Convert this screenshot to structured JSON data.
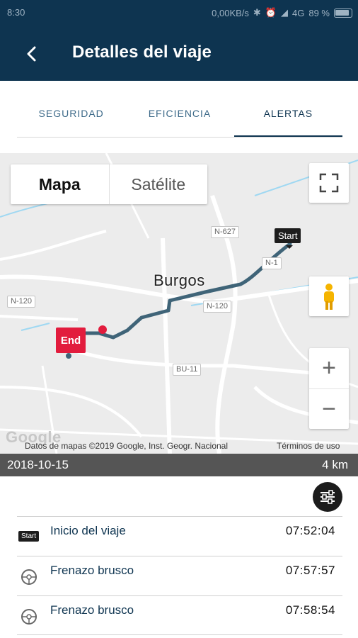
{
  "status_bar": {
    "time": "8:30",
    "speed": "0,00KB/s",
    "network": "4G",
    "battery": "89 %"
  },
  "header": {
    "title": "Detalles del viaje",
    "back_icon": "arrow-left-icon"
  },
  "tabs": [
    {
      "label": "SEGURIDAD",
      "active": false
    },
    {
      "label": "EFICIENCIA",
      "active": false
    },
    {
      "label": "ALERTAS",
      "active": true
    }
  ],
  "map": {
    "type_options": [
      "Mapa",
      "Satélite"
    ],
    "selected_type": "Mapa",
    "city_label": "Burgos",
    "road_labels": [
      "N-627",
      "N-120",
      "N-120",
      "BU-11",
      "N-1"
    ],
    "start_label": "Start",
    "end_label": "End",
    "google_logo": "Google",
    "copyright": "Datos de mapas ©2019 Google, Inst. Geogr. Nacional",
    "terms": "Términos de uso",
    "zoom_in": "+",
    "zoom_out": "−",
    "route_color": "#3f6478",
    "end_color": "#e21c3d"
  },
  "trip": {
    "date": "2018-10-15",
    "distance": "4 km"
  },
  "alerts": [
    {
      "icon": "start-flag-icon",
      "icon_text": "Start",
      "label": "Inicio del viaje",
      "time": "07:52:04"
    },
    {
      "icon": "steering-wheel-icon",
      "label": "Frenazo brusco",
      "time": "07:57:57"
    },
    {
      "icon": "steering-wheel-icon",
      "label": "Frenazo brusco",
      "time": "07:58:54"
    }
  ],
  "colors": {
    "primary": "#0e3450",
    "summary_bar": "#555555"
  }
}
